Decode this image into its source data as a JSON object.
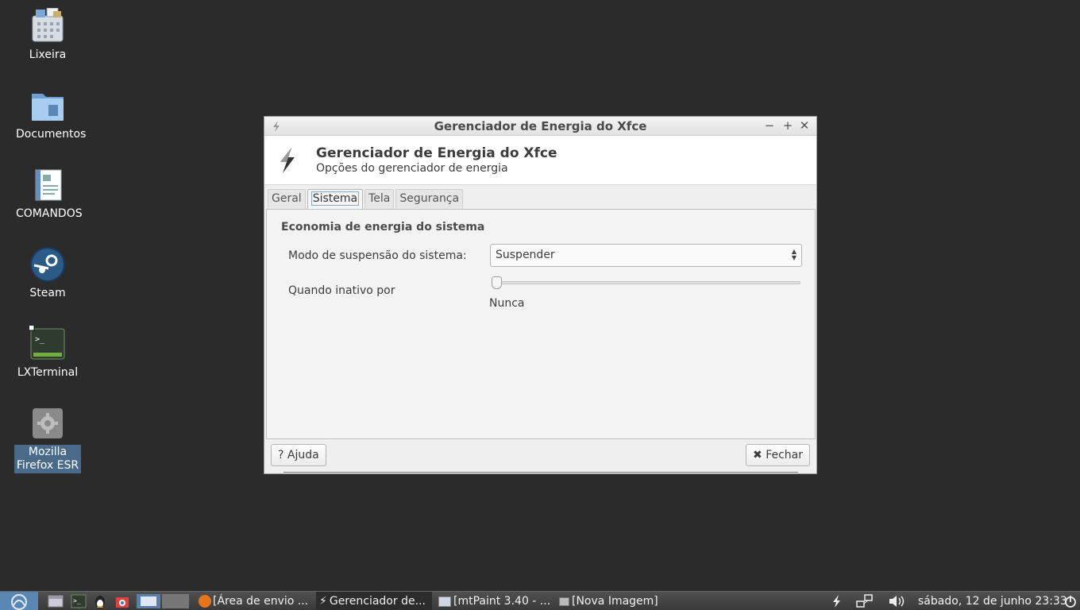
{
  "desktop": {
    "icons": [
      {
        "label": "Lixeira"
      },
      {
        "label": "Documentos"
      },
      {
        "label": "COMANDOS"
      },
      {
        "label": "Steam"
      },
      {
        "label": "LXTerminal"
      },
      {
        "label": "Mozilla Firefox ESR"
      }
    ]
  },
  "window": {
    "title": "Gerenciador de Energia do Xfce",
    "header_title": "Gerenciador de Energia do Xfce",
    "header_subtitle": "Opções do gerenciador de energia",
    "minimize": "−",
    "maximize": "+",
    "close": "✕",
    "tabs": [
      {
        "label": "Geral"
      },
      {
        "label": "Sistema"
      },
      {
        "label": "Tela"
      },
      {
        "label": "Segurança"
      }
    ],
    "section_title": "Economia de energia do sistema",
    "suspend_mode_label": "Modo de suspensão do sistema:",
    "suspend_mode_value": "Suspender",
    "inactive_label": "Quando inativo por",
    "inactive_value": "Nunca",
    "inactive_slider_fraction": 0,
    "help_button": "Ajuda",
    "help_icon": "?",
    "close_button": "Fechar",
    "close_button_icon": "✖"
  },
  "taskbar": {
    "tasks": [
      {
        "label": "[Área de envio ..."
      },
      {
        "label": "Gerenciador de..."
      },
      {
        "label": "[mtPaint 3.40 - ..."
      },
      {
        "label": "[Nova Imagem]"
      }
    ],
    "clock": "sábado, 12 de junho 23:33"
  },
  "colors": {
    "desktop_bg": "#2b2b2b",
    "taskbar_bg": "#444444",
    "selection": "#4a6a8a"
  }
}
